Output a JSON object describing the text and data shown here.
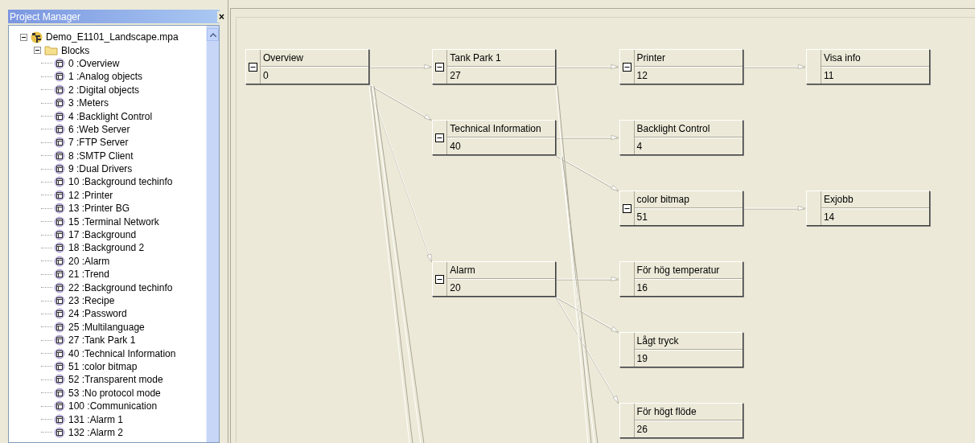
{
  "panel": {
    "title": "Project Manager",
    "close": "×"
  },
  "project_tree": {
    "name": "Demo_E1101_Landscape.mpa",
    "expanded": true,
    "children": [
      {
        "name": "Blocks",
        "expanded": true,
        "children": [
          {
            "name": "0 :Overview"
          },
          {
            "name": "1 :Analog objects"
          },
          {
            "name": "2 :Digital objects"
          },
          {
            "name": "3 :Meters"
          },
          {
            "name": "4 :Backlight Control"
          },
          {
            "name": "6 :Web Server"
          },
          {
            "name": "7 :FTP Server"
          },
          {
            "name": "8 :SMTP Client"
          },
          {
            "name": "9 :Dual Drivers"
          },
          {
            "name": "10 :Background techinfo"
          },
          {
            "name": "12 :Printer"
          },
          {
            "name": "13 :Printer BG"
          },
          {
            "name": "15 :Terminal Network"
          },
          {
            "name": "17 :Background"
          },
          {
            "name": "18 :Background 2"
          },
          {
            "name": "20 :Alarm"
          },
          {
            "name": "21 :Trend"
          },
          {
            "name": "22 :Background techinfo"
          },
          {
            "name": "23 :Recipe"
          },
          {
            "name": "24 :Password"
          },
          {
            "name": "25 :Multilanguage"
          },
          {
            "name": "27 :Tank Park 1"
          },
          {
            "name": "40 :Technical Information"
          },
          {
            "name": "51 :color bitmap"
          },
          {
            "name": "52 :Transparent mode"
          },
          {
            "name": "53 :No protocol mode"
          },
          {
            "name": "100 :Communication"
          },
          {
            "name": "131 :Alarm 1"
          },
          {
            "name": "132 :Alarm 2"
          }
        ]
      }
    ]
  },
  "diagram": {
    "root": {
      "title": "Overview",
      "number": "0",
      "kind": "expandable",
      "expanded": true,
      "children": [
        {
          "title": "Tank Park 1",
          "number": "27",
          "kind": "expandable",
          "expanded": true,
          "children": [
            {
              "title": "Printer",
              "number": "12",
              "kind": "expandable",
              "expanded": true,
              "children": [
                {
                  "title": "Visa info",
                  "number": "11",
                  "kind": "leaf"
                }
              ]
            }
          ]
        },
        {
          "title": "Technical Information",
          "number": "40",
          "kind": "expandable",
          "expanded": true,
          "children": [
            {
              "title": "Backlight Control",
              "number": "4",
              "kind": "leaf"
            },
            {
              "title": "color bitmap",
              "number": "51",
              "kind": "expandable",
              "expanded": true,
              "children": [
                {
                  "title": "Exjobb",
                  "number": "14",
                  "kind": "leaf"
                }
              ]
            }
          ]
        },
        {
          "title": "Alarm",
          "number": "20",
          "kind": "expandable",
          "expanded": true,
          "children": [
            {
              "title": "För hög temperatur",
              "number": "16",
              "kind": "leaf"
            },
            {
              "title": "Lågt tryck",
              "number": "19",
              "kind": "leaf"
            },
            {
              "title": "För högt flöde",
              "number": "26",
              "kind": "leaf"
            }
          ]
        }
      ]
    }
  }
}
